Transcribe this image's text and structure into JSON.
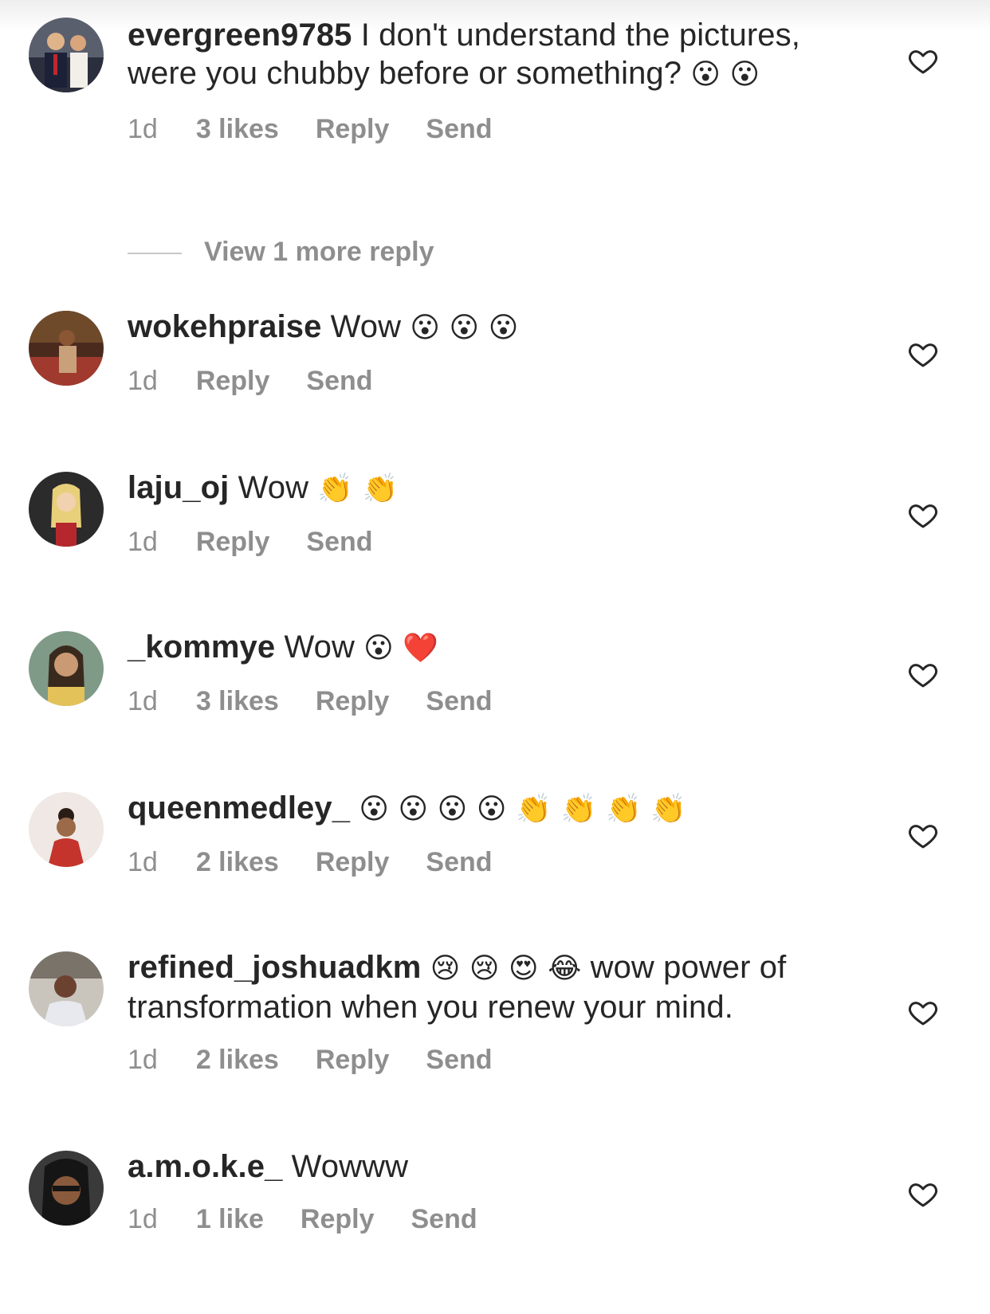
{
  "icons": {
    "like": "heart-outline-icon"
  },
  "colors": {
    "text": "#262626",
    "meta": "#8e8e8e",
    "divider": "#c7c7c7",
    "background": "#ffffff"
  },
  "comments": [
    {
      "username": "evergreen9785",
      "text": "I don't understand the pictures, were you chubby before or something?",
      "emoji": "😮 😮",
      "time": "1d",
      "likes": "3 likes",
      "reply": "Reply",
      "send": "Send"
    },
    {
      "username": "wokehpraise",
      "text": "Wow",
      "emoji": "😮 😮 😮",
      "time": "1d",
      "likes": "",
      "reply": "Reply",
      "send": "Send"
    },
    {
      "username": "laju_oj",
      "text": "Wow",
      "emoji": "👏 👏",
      "time": "1d",
      "likes": "",
      "reply": "Reply",
      "send": "Send"
    },
    {
      "username": "_kommye",
      "text": "Wow",
      "emoji": "😮 ❤️",
      "time": "1d",
      "likes": "3 likes",
      "reply": "Reply",
      "send": "Send"
    },
    {
      "username": "queenmedley_",
      "text": "",
      "emoji": "😮 😮 😮 😮 👏 👏 👏 👏",
      "time": "1d",
      "likes": "2 likes",
      "reply": "Reply",
      "send": "Send"
    },
    {
      "username": "refined_joshuadkm",
      "text": "wow power of transformation when you renew your mind.",
      "emoji": "😢 😢 😍 😂",
      "time": "1d",
      "likes": "2 likes",
      "reply": "Reply",
      "send": "Send"
    },
    {
      "username": "a.m.o.k.e_",
      "text": "Wowww",
      "emoji": "",
      "time": "1d",
      "likes": "1 like",
      "reply": "Reply",
      "send": "Send"
    }
  ],
  "view_more_replies": "View 1 more reply"
}
